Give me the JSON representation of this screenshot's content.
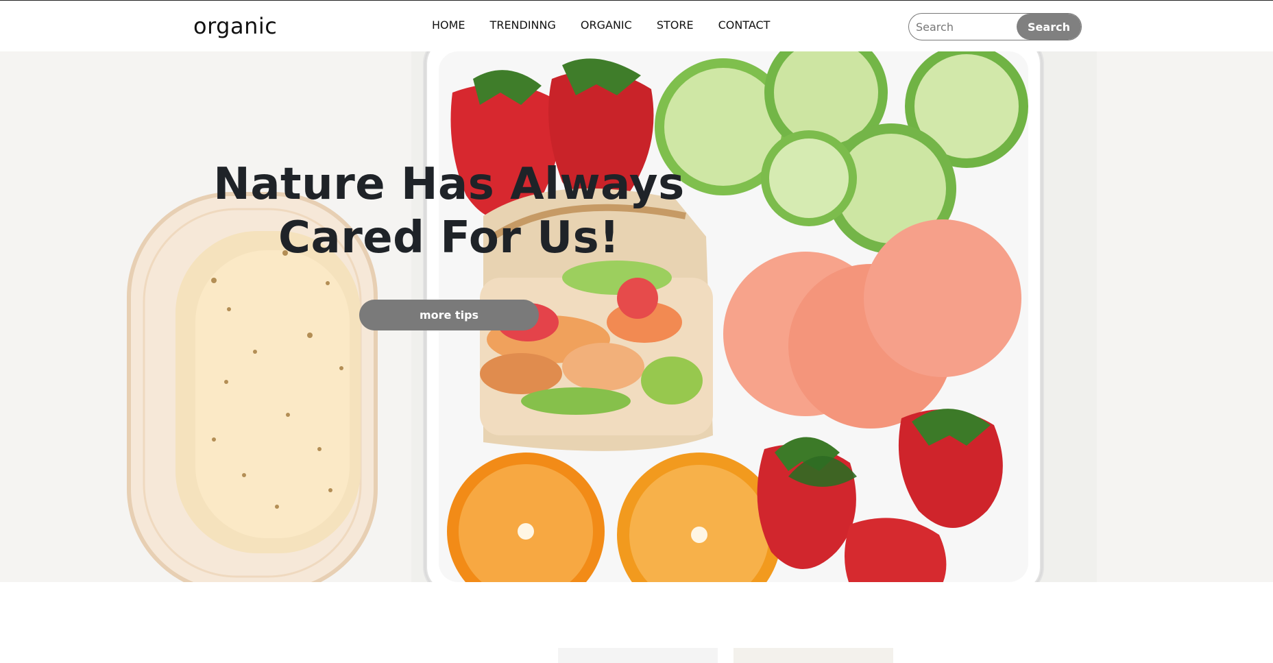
{
  "header": {
    "logo": "organic",
    "nav": [
      "HOME",
      "TRENDINNG",
      "ORGANIC",
      "STORE",
      "CONTACT"
    ],
    "search": {
      "placeholder": "Search",
      "button_label": "Search"
    }
  },
  "hero": {
    "title_line1": "Nature Has Always",
    "title_line2": "Cared For Us!",
    "button_label": "more tips"
  }
}
